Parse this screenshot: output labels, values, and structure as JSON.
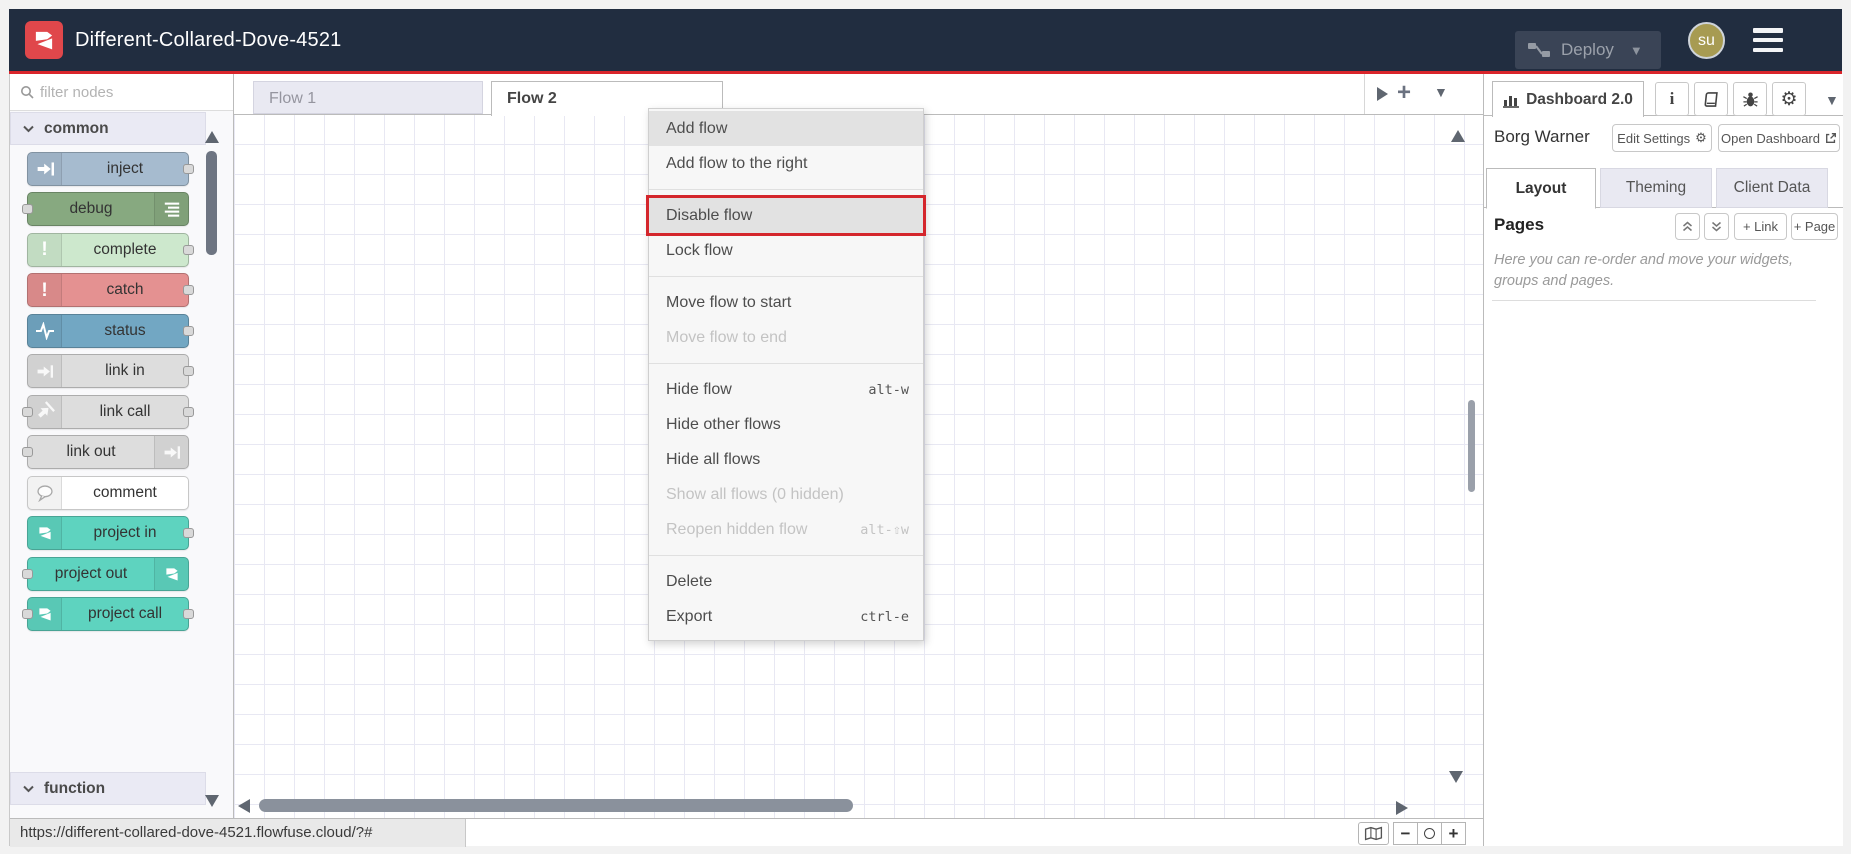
{
  "header": {
    "title": "Different-Collared-Dove-4521",
    "deploy_label": "Deploy",
    "avatar_text": "su"
  },
  "palette": {
    "filter_placeholder": "filter nodes",
    "categories": {
      "common": "common",
      "function": "function"
    },
    "nodes": [
      {
        "label": "inject",
        "bg": "#a6bbcf",
        "icon": "inject-arrow-icon",
        "icon_side": "left",
        "port_left": false,
        "port_right": true
      },
      {
        "label": "debug",
        "bg": "#87a980",
        "icon": "debug-list-icon",
        "icon_side": "right",
        "port_left": true,
        "port_right": false
      },
      {
        "label": "complete",
        "bg": "#cde8cd",
        "icon": "exclamation-icon",
        "icon_side": "left",
        "port_left": false,
        "port_right": true
      },
      {
        "label": "catch",
        "bg": "#e49191",
        "icon": "exclamation-icon",
        "icon_side": "left",
        "port_left": false,
        "port_right": true
      },
      {
        "label": "status",
        "bg": "#72a7c3",
        "icon": "pulse-icon",
        "icon_side": "left",
        "port_left": false,
        "port_right": true
      },
      {
        "label": "link in",
        "bg": "#dddddd",
        "icon": "link-arrow-icon",
        "icon_side": "left",
        "port_left": false,
        "port_right": true
      },
      {
        "label": "link call",
        "bg": "#dddddd",
        "icon": "link-call-icon",
        "icon_side": "left",
        "port_left": true,
        "port_right": true
      },
      {
        "label": "link out",
        "bg": "#dddddd",
        "icon": "link-arrow-icon",
        "icon_side": "right",
        "port_left": true,
        "port_right": false
      },
      {
        "label": "comment",
        "bg": "#ffffff",
        "icon": "comment-bubble-icon",
        "icon_side": "left",
        "port_left": false,
        "port_right": false
      },
      {
        "label": "project in",
        "bg": "#5ed3bf",
        "icon": "node-red-logo-icon",
        "icon_side": "left",
        "port_left": false,
        "port_right": true
      },
      {
        "label": "project out",
        "bg": "#5ed3bf",
        "icon": "node-red-logo-icon",
        "icon_side": "right",
        "port_left": true,
        "port_right": false
      },
      {
        "label": "project call",
        "bg": "#5ed3bf",
        "icon": "node-red-logo-icon",
        "icon_side": "left",
        "port_left": true,
        "port_right": true
      }
    ]
  },
  "canvas": {
    "tabs": [
      {
        "label": "Flow 1",
        "active": false
      },
      {
        "label": "Flow 2",
        "active": true
      }
    ]
  },
  "context_menu": {
    "items": [
      {
        "label": "Add flow",
        "hover": true
      },
      {
        "label": "Add flow to the right"
      },
      {
        "divider": true
      },
      {
        "label": "Disable flow",
        "annotated": true
      },
      {
        "label": "Lock flow"
      },
      {
        "divider": true
      },
      {
        "label": "Move flow to start"
      },
      {
        "label": "Move flow to end",
        "disabled": true
      },
      {
        "divider": true
      },
      {
        "label": "Hide flow",
        "shortcut": "alt-w"
      },
      {
        "label": "Hide other flows"
      },
      {
        "label": "Hide all flows"
      },
      {
        "label": "Show all flows (0 hidden)",
        "disabled": true
      },
      {
        "label": "Reopen hidden flow",
        "disabled": true,
        "shortcut": "alt-⇧w"
      },
      {
        "divider": true
      },
      {
        "label": "Delete"
      },
      {
        "label": "Export",
        "shortcut": "ctrl-e"
      }
    ]
  },
  "sidebar": {
    "tab_label": "Dashboard 2.0",
    "project_label": "Borg Warner",
    "edit_settings_label": "Edit Settings",
    "open_dashboard_label": "Open Dashboard",
    "tabs": [
      {
        "label": "Layout",
        "active": true
      },
      {
        "label": "Theming",
        "active": false
      },
      {
        "label": "Client Data",
        "active": false
      }
    ],
    "pages_title": "Pages",
    "link_button_label": "+ Link",
    "page_button_label": "+ Page",
    "help_text": "Here you can re-order and move your widgets, groups and pages."
  },
  "footer": {
    "url": "https://different-collared-dove-4521.flowfuse.cloud/?#"
  },
  "colors": {
    "accent_red": "#d9252b",
    "header_bg": "#212d40",
    "annotation_red": "#d4262c",
    "avatar_bg": "#a79b52",
    "project_teal": "#5ed3bf"
  }
}
